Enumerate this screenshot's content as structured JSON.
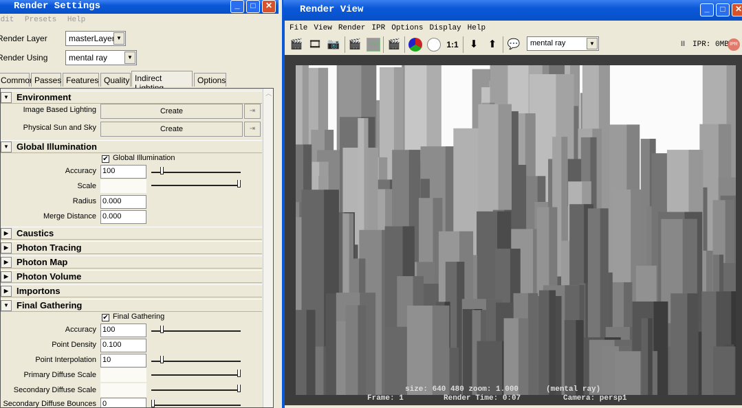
{
  "render_settings": {
    "title": "Render Settings",
    "menu": [
      "Edit",
      "Presets",
      "Help"
    ],
    "render_layer_label": "Render Layer",
    "render_layer_value": "masterLayer",
    "render_using_label": "Render Using",
    "render_using_value": "mental ray",
    "tabs": [
      "Common",
      "Passes",
      "Features",
      "Quality",
      "Indirect Lighting",
      "Options"
    ],
    "active_tab": "Indirect Lighting",
    "environment": {
      "title": "Environment",
      "ibl_label": "Image Based Lighting",
      "sun_label": "Physical Sun and Sky",
      "create": "Create"
    },
    "gi": {
      "title": "Global Illumination",
      "checkbox": "Global Illumination",
      "checked": true,
      "accuracy_label": "Accuracy",
      "accuracy": "100",
      "accuracy_slider": 0.1,
      "scale_label": "Scale",
      "scale_slider": 1.0,
      "radius_label": "Radius",
      "radius": "0.000",
      "merge_label": "Merge Distance",
      "merge": "0.000"
    },
    "collapsed": [
      "Caustics",
      "Photon Tracing",
      "Photon Map",
      "Photon Volume",
      "Importons"
    ],
    "fg": {
      "title": "Final Gathering",
      "checkbox": "Final Gathering",
      "checked": true,
      "accuracy_label": "Accuracy",
      "accuracy": "100",
      "accuracy_slider": 0.1,
      "density_label": "Point Density",
      "density": "0.100",
      "interp_label": "Point Interpolation",
      "interp": "10",
      "interp_slider": 0.1,
      "primary_label": "Primary Diffuse Scale",
      "primary_slider": 1.0,
      "secondary_label": "Secondary Diffuse Scale",
      "secondary_slider": 1.0,
      "bounces_label": "Secondary Diffuse Bounces",
      "bounces": "0",
      "bounces_slider": 0.0
    }
  },
  "render_view": {
    "title": "Render View",
    "menu": [
      "File",
      "View",
      "Render",
      "IPR",
      "Options",
      "Display",
      "Help"
    ],
    "renderer": "mental ray",
    "ratio": "1:1",
    "ipr_memory": "IPR: 0MB",
    "ipr_badge": "IPR",
    "image_info": "size:  640  480 zoom: 1.000",
    "image_renderer": "(mental ray)",
    "frame": "Frame: 1",
    "render_time": "Render Time: 0:07",
    "camera": "Camera: persp1"
  }
}
